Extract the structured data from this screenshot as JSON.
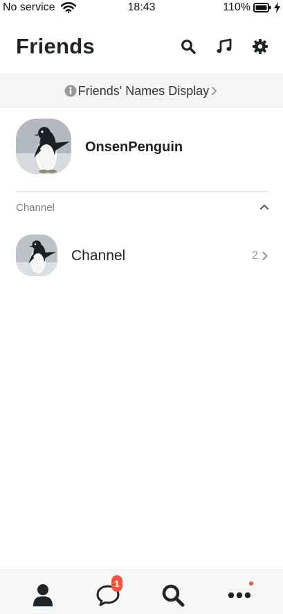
{
  "status_bar": {
    "carrier": "No service",
    "time": "18:43",
    "battery": "110%"
  },
  "header": {
    "title": "Friends",
    "icons": [
      "search-icon",
      "music-icon",
      "gear-icon"
    ]
  },
  "banner": {
    "label": "Friends' Names Display"
  },
  "profile": {
    "name": "OnsenPenguin"
  },
  "channel_section": {
    "title": "Channel",
    "items": [
      {
        "name": "Channel",
        "count": "2"
      }
    ]
  },
  "tab_bar": {
    "tabs": [
      "friends",
      "chats",
      "search",
      "more"
    ],
    "chats_badge": "1"
  },
  "colors": {
    "accent_badge": "#f4553d",
    "banner_bg": "#f5f5f5",
    "text_dark": "#1f2428"
  }
}
